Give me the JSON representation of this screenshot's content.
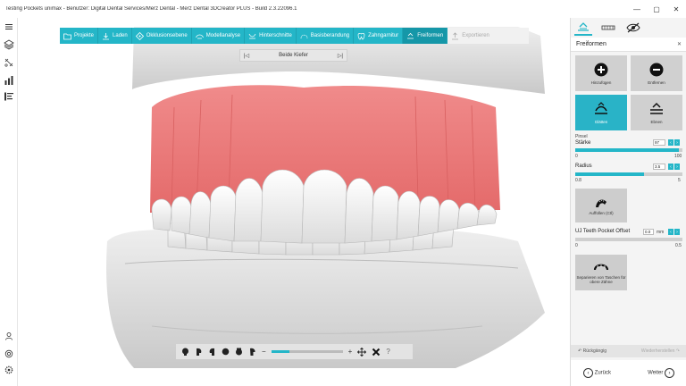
{
  "window": {
    "title": "Testing Pockets unimax - Benutzer: Digital Dental Services/Merz Dental - Merz Dental 3DCreator PLUS - Build 2.3.22096.1",
    "minimize": "—",
    "maximize": "▢",
    "close": "✕"
  },
  "workflow": {
    "steps": [
      {
        "label": "Projekte",
        "icon": "folder-icon"
      },
      {
        "label": "Laden",
        "icon": "load-icon"
      },
      {
        "label": "Okklusionsebene",
        "icon": "occlusion-plane-icon"
      },
      {
        "label": "Modellanalyse",
        "icon": "model-analysis-icon"
      },
      {
        "label": "Hinterschnitte",
        "icon": "undercut-icon"
      },
      {
        "label": "Basisberandung",
        "icon": "base-outline-icon"
      },
      {
        "label": "Zahngarnitur",
        "icon": "tooth-set-icon"
      },
      {
        "label": "Freiformen",
        "icon": "freeform-icon"
      },
      {
        "label": "Exportieren",
        "icon": "export-icon"
      }
    ]
  },
  "jaw_selector": {
    "label": "Beide Kiefer",
    "prev": "|◁",
    "next": "▷|"
  },
  "view_toolbar": {
    "zoom_fraction": 0.25,
    "minus": "−",
    "plus": "+",
    "help": "?"
  },
  "panel": {
    "header": "Freiformen",
    "tools": [
      {
        "label": "Hinzufügen",
        "icon": "plus-circle-icon"
      },
      {
        "label": "Entfernen",
        "icon": "minus-circle-icon"
      },
      {
        "label": "Glätten",
        "icon": "smooth-icon"
      },
      {
        "label": "Ebnen",
        "icon": "flatten-icon"
      }
    ],
    "section": "Pinsel",
    "staerke": {
      "label": "Stärke",
      "value": "97",
      "min": "0",
      "max": "100",
      "fraction": 0.97
    },
    "radius": {
      "label": "Radius",
      "value": "3.5",
      "min": "0.8",
      "max": "5",
      "fraction": 0.64
    },
    "auffuellen": "Auffüllen (Ctl)",
    "pocket": {
      "label": "UJ Teeth Pocket Offset",
      "value": "0.0",
      "unit": "mm",
      "min": "0",
      "max": "0.5",
      "fraction": 0.0
    },
    "separate": "Separieren von Taschen für obere Zähne",
    "undo": "Rückgängig",
    "redo": "Wiederherstellen",
    "back": "Zurück",
    "next": "Weiter"
  },
  "colors": {
    "accent": "#24b6c8",
    "gum": "#ee7a7a",
    "model": "#d9d9d9"
  }
}
